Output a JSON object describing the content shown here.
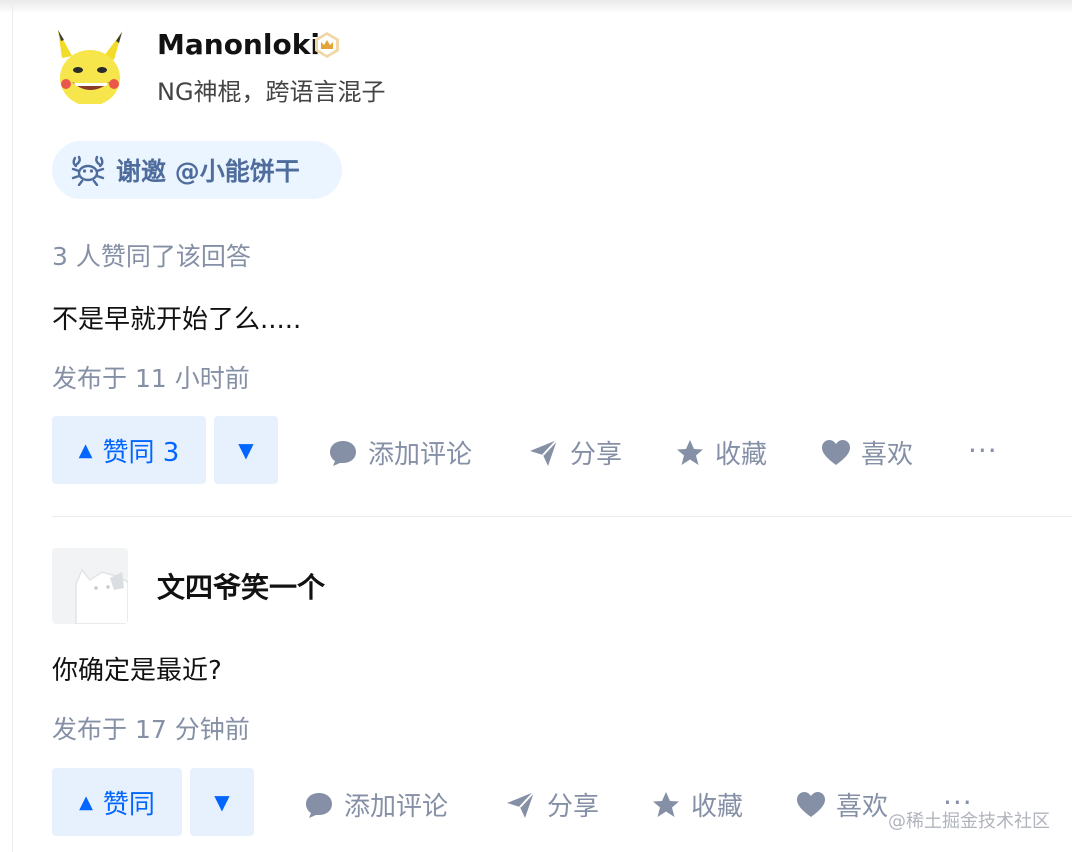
{
  "answer": {
    "author": {
      "name": "Manonloki",
      "headline": "NG神棍，跨语言混子",
      "badge": "gold-crown-badge-icon"
    },
    "invite": {
      "text": "谢邀 @小能饼干",
      "icon": "crab-icon"
    },
    "votes_summary": "3 人赞同了该回答",
    "content": "不是早就开始了么.....",
    "published": "发布于 11 小时前",
    "actions": {
      "upvote_label": "赞同 3",
      "comment": "添加评论",
      "share": "分享",
      "collect": "收藏",
      "like": "喜欢",
      "more": "···"
    }
  },
  "comment": {
    "author": {
      "name": "文四爷笑一个"
    },
    "content": "你确定是最近?",
    "published": "发布于 17 分钟前",
    "actions": {
      "upvote_label": "赞同",
      "comment": "添加评论",
      "share": "分享",
      "collect": "收藏",
      "like": "喜欢",
      "more": "···"
    }
  },
  "watermark": "@稀土掘金技术社区",
  "colors": {
    "accent": "#0066ff",
    "meta": "#8590a6",
    "invite_bg": "#ebf5ff",
    "vote_bg": "#e7f0fd"
  }
}
